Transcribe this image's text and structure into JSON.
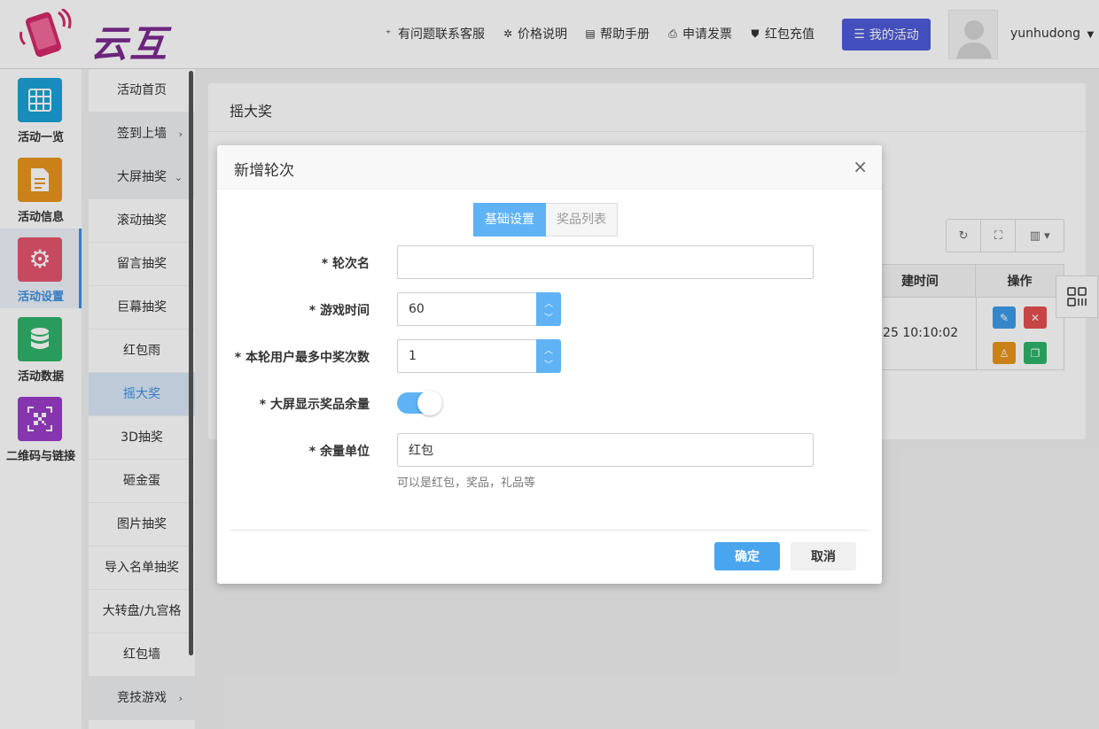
{
  "brand": {
    "name": "云互动"
  },
  "topnav": [
    {
      "label": "有问题联系客服",
      "icon": "user-plus-icon"
    },
    {
      "label": "价格说明",
      "icon": "gear-badge-icon"
    },
    {
      "label": "帮助手册",
      "icon": "book-icon"
    },
    {
      "label": "申请发票",
      "icon": "printer-icon"
    },
    {
      "label": "红包充值",
      "icon": "shield-check-icon"
    }
  ],
  "my_activity": "我的活动",
  "user": {
    "name": "yunhudong"
  },
  "leftbar": [
    {
      "label": "活动一览",
      "color": "#1aa3d6",
      "icon": "grid-icon"
    },
    {
      "label": "活动信息",
      "color": "#e8961c",
      "icon": "document-icon"
    },
    {
      "label": "活动设置",
      "color": "#e5546f",
      "icon": "gear-icon",
      "active": true
    },
    {
      "label": "活动数据",
      "color": "#2fb46a",
      "icon": "database-icon"
    },
    {
      "label": "二维码与链接",
      "color": "#9b3cc9",
      "icon": "qrcode-icon"
    }
  ],
  "subnav": [
    {
      "label": "活动首页"
    },
    {
      "label": "签到上墙",
      "arrow": "›"
    },
    {
      "label": "大屏抽奖",
      "arrow": "⌄"
    },
    {
      "label": "滚动抽奖"
    },
    {
      "label": "留言抽奖"
    },
    {
      "label": "巨幕抽奖"
    },
    {
      "label": "红包雨"
    },
    {
      "label": "摇大奖",
      "active": true
    },
    {
      "label": "3D抽奖"
    },
    {
      "label": "砸金蛋"
    },
    {
      "label": "图片抽奖"
    },
    {
      "label": "导入名单抽奖"
    },
    {
      "label": "大转盘/九宫格"
    },
    {
      "label": "红包墙"
    },
    {
      "label": "竞技游戏",
      "arrow": "›"
    }
  ],
  "panel": {
    "title": "摇大奖",
    "table": {
      "headers": [
        "建时间",
        "操作"
      ],
      "rows": [
        {
          "time": "-25 10:10:02"
        }
      ]
    }
  },
  "modal": {
    "title": "新增轮次",
    "close": "×",
    "tabs": [
      "基础设置",
      "奖品列表"
    ],
    "fields": {
      "round_name": {
        "label": "* 轮次名",
        "value": ""
      },
      "game_time": {
        "label": "* 游戏时间",
        "value": "60"
      },
      "max_wins": {
        "label": "* 本轮用户最多中奖次数",
        "value": "1"
      },
      "show_remaining": {
        "label": "* 大屏显示奖品余量",
        "on": true
      },
      "unit": {
        "label": "* 余量单位",
        "value": "红包",
        "hint": "可以是红包，奖品，礼品等"
      }
    },
    "ok": "确定",
    "cancel": "取消"
  },
  "colors": {
    "accent": "#5fb3f5",
    "primary_btn": "#4e5bd8",
    "danger": "#e55050",
    "warning": "#e8961c",
    "success": "#2fb46a"
  }
}
